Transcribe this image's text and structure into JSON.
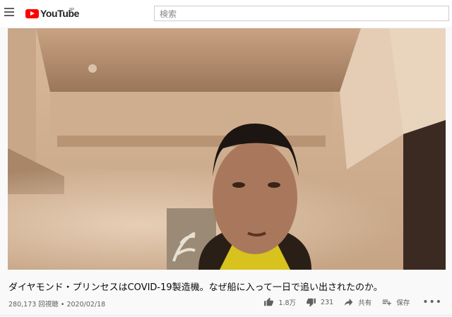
{
  "header": {
    "logo_text": "YouTube",
    "region": "JP",
    "search_placeholder": "検索"
  },
  "video": {
    "title": "ダイヤモンド・プリンセスはCOVID-19製造機。なぜ船に入って一日で追い出されたのか。",
    "views": "280,173 回視聴",
    "separator": "•",
    "date": "2020/02/18",
    "meta_line": "280,173 回視聴 • 2020/02/18"
  },
  "actions": {
    "like_count": "1.8万",
    "dislike_count": "231",
    "share_label": "共有",
    "save_label": "保存",
    "more_label": "•••"
  },
  "colors": {
    "brand_red": "#ff0000",
    "text_primary": "#0a0a0a",
    "text_secondary": "#606060"
  },
  "icons": {
    "menu": "hamburger-menu-icon",
    "like": "thumbs-up-icon",
    "dislike": "thumbs-down-icon",
    "share": "share-arrow-icon",
    "save": "playlist-add-icon",
    "more": "more-horiz-icon"
  }
}
